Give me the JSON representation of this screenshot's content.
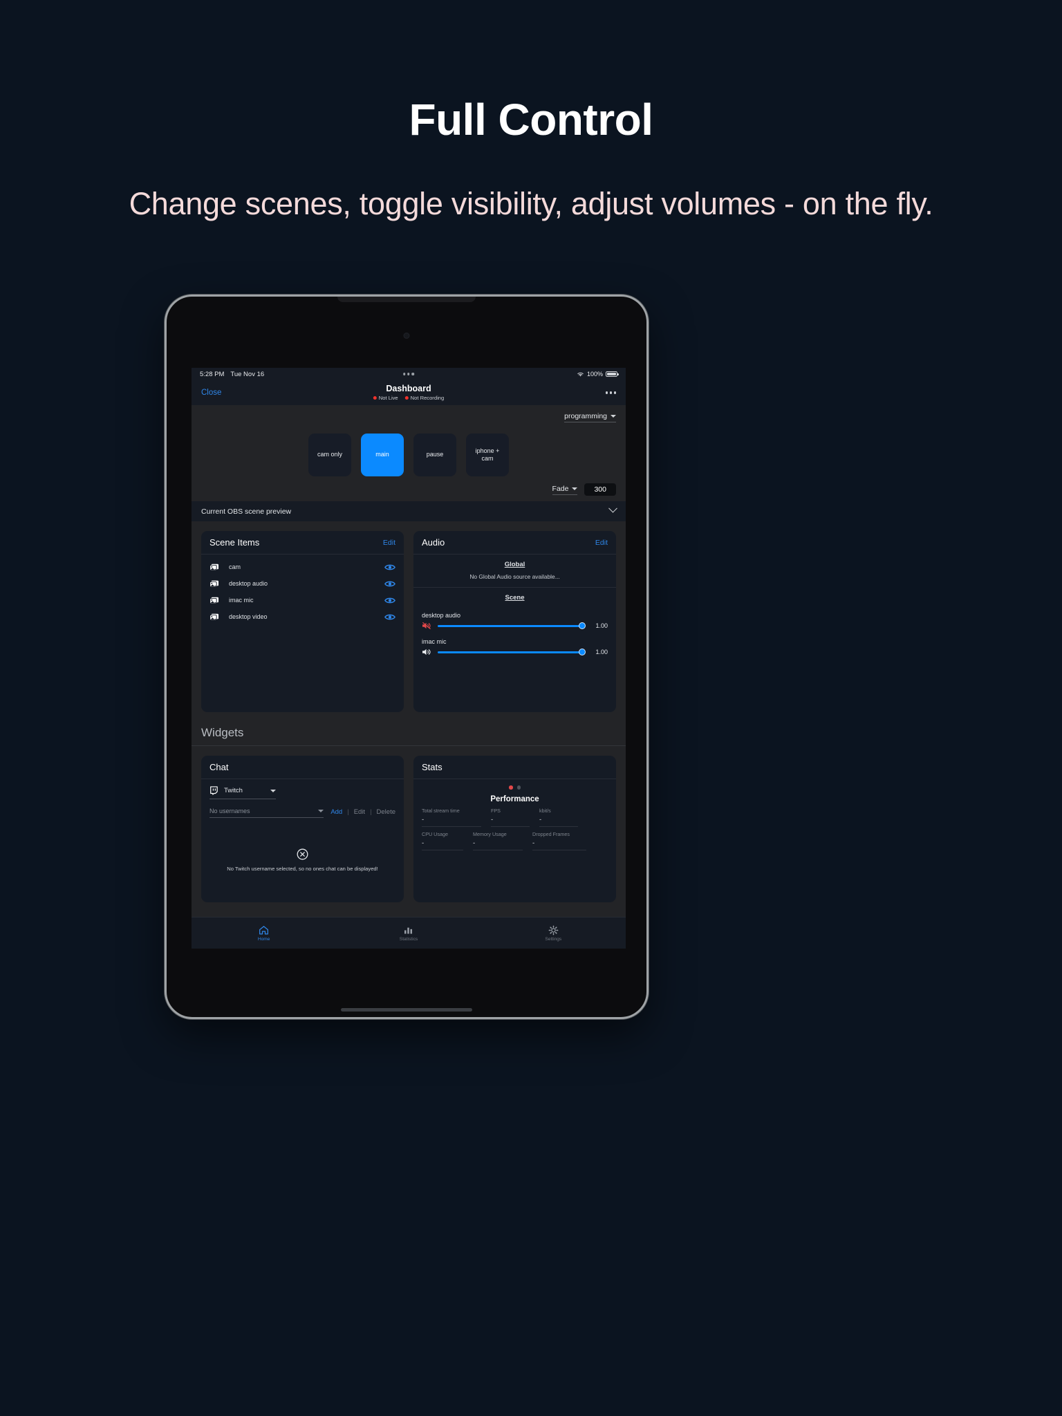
{
  "hero": {
    "title": "Full Control",
    "subtitle": "Change scenes, toggle visibility, adjust volumes - on the fly."
  },
  "statusbar": {
    "time": "5:28 PM",
    "date": "Tue Nov 16",
    "battery_percent": "100%"
  },
  "navbar": {
    "close_label": "Close",
    "title": "Dashboard",
    "live_status": "Not Live",
    "recording_status": "Not Recording"
  },
  "scenes": {
    "collection_label": "programming",
    "buttons": [
      {
        "label": "cam only",
        "active": false
      },
      {
        "label": "main",
        "active": true
      },
      {
        "label": "pause",
        "active": false
      },
      {
        "label": "iphone + cam",
        "active": false
      }
    ],
    "transition_label": "Fade",
    "transition_duration": "300"
  },
  "preview": {
    "label": "Current OBS scene preview"
  },
  "scene_items": {
    "title": "Scene Items",
    "edit_label": "Edit",
    "items": [
      {
        "label": "cam"
      },
      {
        "label": "desktop audio"
      },
      {
        "label": "imac mic"
      },
      {
        "label": "desktop video"
      }
    ]
  },
  "audio": {
    "title": "Audio",
    "edit_label": "Edit",
    "global_heading": "Global",
    "global_empty": "No Global Audio source available...",
    "scene_heading": "Scene",
    "sources": [
      {
        "name": "desktop audio",
        "value": "1.00",
        "muted": true
      },
      {
        "name": "imac mic",
        "value": "1.00",
        "muted": false
      }
    ]
  },
  "widgets": {
    "heading": "Widgets"
  },
  "chat": {
    "title": "Chat",
    "platform": "Twitch",
    "username_placeholder": "No usernames",
    "add_label": "Add",
    "edit_label": "Edit",
    "delete_label": "Delete",
    "empty_message": "No Twitch username selected, so no ones chat can be displayed!"
  },
  "stats": {
    "title": "Stats",
    "section_title": "Performance",
    "metrics": [
      {
        "label": "Total stream time",
        "value": "-"
      },
      {
        "label": "FPS",
        "value": "-"
      },
      {
        "label": "kbit/s",
        "value": "-"
      },
      {
        "label": "CPU Usage",
        "value": "-"
      },
      {
        "label": "Memory Usage",
        "value": "-"
      },
      {
        "label": "Dropped Frames",
        "value": "-"
      }
    ]
  },
  "tabbar": {
    "tabs": [
      {
        "label": "Home",
        "active": true
      },
      {
        "label": "Statistics",
        "active": false
      },
      {
        "label": "Settings",
        "active": false
      }
    ]
  },
  "colors": {
    "accent_blue": "#0b8aff",
    "link_blue": "#2f86e8",
    "status_red": "#f0322c",
    "background": "#0b1420"
  }
}
